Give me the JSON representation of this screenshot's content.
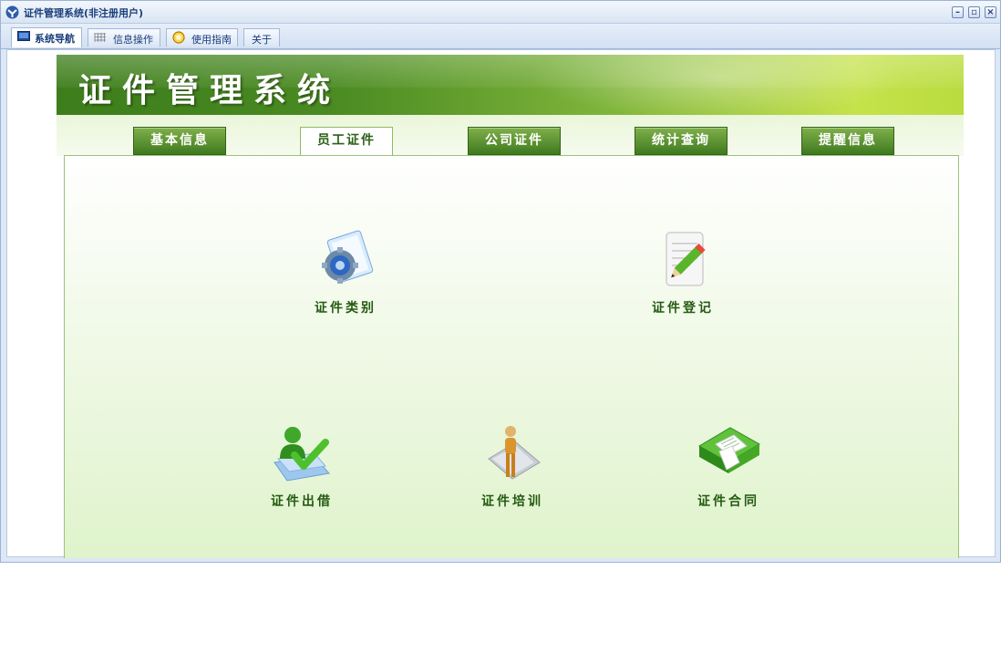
{
  "window": {
    "title": "证件管理系统(非注册用户)",
    "controls": [
      "minimize",
      "restore",
      "close"
    ]
  },
  "top_tabs": [
    {
      "label": "系统导航",
      "icon": "monitor-icon",
      "active": true
    },
    {
      "label": "信息操作",
      "icon": "grid-icon",
      "active": false
    },
    {
      "label": "使用指南",
      "icon": "help-circle-icon",
      "active": false
    },
    {
      "label": "关于",
      "icon": "",
      "active": false
    }
  ],
  "banner": {
    "title": "证件管理系统"
  },
  "module_tabs": [
    {
      "label": "基本信息",
      "active": false
    },
    {
      "label": "员工证件",
      "active": true
    },
    {
      "label": "公司证件",
      "active": false
    },
    {
      "label": "统计查询",
      "active": false
    },
    {
      "label": "提醒信息",
      "active": false
    }
  ],
  "features": [
    {
      "label": "证件类别",
      "icon": "gear-document-icon"
    },
    {
      "label": "证件登记",
      "icon": "pencil-note-icon"
    },
    {
      "label": "证件出借",
      "icon": "user-check-icon"
    },
    {
      "label": "证件培训",
      "icon": "trainer-icon"
    },
    {
      "label": "证件合同",
      "icon": "contract-book-icon"
    }
  ],
  "colors": {
    "banner_dark": "#3d7d1b",
    "banner_light": "#c5e24b",
    "tab_green": "#3f7a20",
    "label_green": "#245a10",
    "window_blue": "#1b3f7a"
  }
}
